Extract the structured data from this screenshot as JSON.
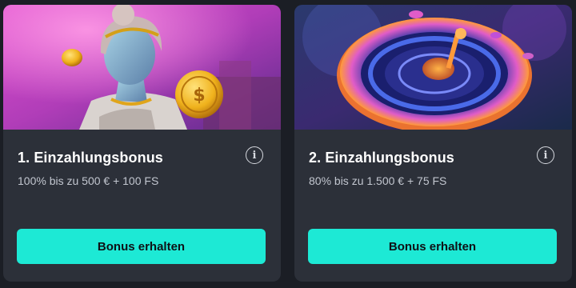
{
  "cards": [
    {
      "title": "1. Einzahlungsbonus",
      "subtitle": "100% bis zu 500 € + 100 FS",
      "button_label": "Bonus erhalten",
      "info_icon": "i",
      "image": "statue-with-gold-coin"
    },
    {
      "title": "2. Einzahlungsbonus",
      "subtitle": "80% bis zu 1.500 € + 75 FS",
      "button_label": "Bonus erhalten",
      "info_icon": "i",
      "image": "neon-roulette-wheel"
    }
  ],
  "colors": {
    "background": "#1b1e25",
    "card": "#2c3039",
    "accent": "#1de9d5"
  }
}
